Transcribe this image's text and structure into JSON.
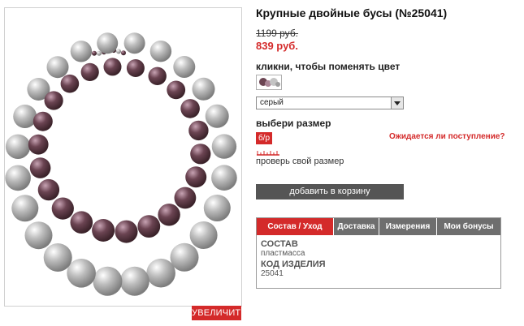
{
  "product": {
    "title": "Крупные двойные бусы (№25041)",
    "old_price": "1199 руб.",
    "new_price": "839 руб."
  },
  "image": {
    "zoom_label": "УВЕЛИЧИТЬ",
    "bead_colors": {
      "silver": "#bdbdbd",
      "plum": "#6b4452"
    }
  },
  "color_picker": {
    "label": "кликни, чтобы поменять цвет",
    "selected": "серый"
  },
  "size": {
    "label": "выбери размер",
    "selected_chip": "б/р",
    "arrival_link": "Ожидается ли поступление?",
    "check_size_label": "проверь свой размер",
    "ruler_icon": "ruler-icon"
  },
  "cart": {
    "add_label": "добавить в корзину"
  },
  "tabs": {
    "items": [
      {
        "label": "Состав / Уход",
        "active": true
      },
      {
        "label": "Доставка",
        "active": false
      },
      {
        "label": "Измерения",
        "active": false
      },
      {
        "label": "Мои бонусы",
        "active": false
      }
    ],
    "content": {
      "composition_heading": "СОСТАВ",
      "composition_value": "пластмасса",
      "code_heading": "КОД ИЗДЕЛИЯ",
      "code_value": "25041"
    }
  },
  "colors": {
    "accent": "#d42a2a",
    "button_dark": "#555555",
    "tab_inactive": "#6e6e6e"
  }
}
